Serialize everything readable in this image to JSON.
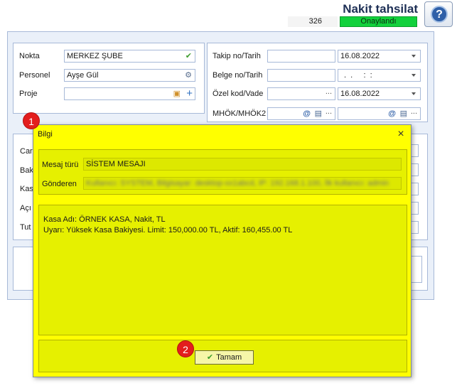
{
  "header": {
    "title": "Nakit tahsilat",
    "help_glyph": "?",
    "doc_number": "326",
    "status": "Onaylandı"
  },
  "left_panel": {
    "nokta_label": "Nokta",
    "nokta_value": "MERKEZ ŞUBE",
    "personel_label": "Personel",
    "personel_value": "Ayşe Gül",
    "proje_label": "Proje",
    "proje_value": ""
  },
  "right_panel": {
    "takip_label": "Takip no/Tarih",
    "takip_value": "",
    "takip_date": "16.08.2022",
    "belge_label": "Belge no/Tarih",
    "belge_value": "",
    "belge_date": ".  .     :  :",
    "ozel_label": "Özel kod/Vade",
    "ozel_value": "",
    "vade_date": "16.08.2022",
    "mhok_label": "MHÖK/MHÖK2",
    "mhok_value1": "",
    "mhok_value2": "",
    "at_glyph": "@",
    "ellipsis_glyph": "..."
  },
  "partial_labels": [
    "Car",
    "Bak",
    "Kas",
    "Açı",
    "Tut"
  ],
  "dialog": {
    "title": "Bilgi",
    "close_glyph": "×",
    "mesaj_turu_label": "Mesaj türü",
    "mesaj_turu_value": "SİSTEM MESAJI",
    "gonderen_label": "Gönderen",
    "gonderen_value": "Kullanıcı: SYSTEM, Bilgisayar: desktop-xx1abcd, IP: 192.168.1.100, İlk kullanıcı: admin",
    "message_line1": "Kasa Adı: ÖRNEK KASA, Nakit, TL",
    "message_line2": "Uyarı: Yüksek Kasa Bakiyesi. Limit: 150,000.00 TL, Aktif: 160,455.00 TL",
    "ok_label": "Tamam",
    "check_glyph": "✔"
  },
  "badges": {
    "first": "1",
    "second": "2"
  },
  "colors": {
    "dialog_bg": "#ffff00",
    "status_green": "#12d13c",
    "badge_red": "#e31d1d"
  }
}
